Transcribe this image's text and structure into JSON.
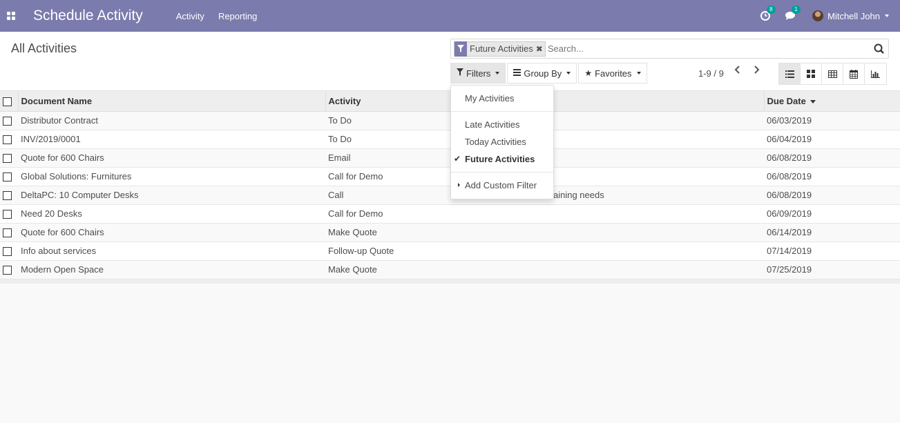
{
  "navbar": {
    "app_title": "Schedule Activity",
    "menu": [
      "Activity",
      "Reporting"
    ],
    "activity_badge": "8",
    "message_badge": "1",
    "user_name": "Mitchell John"
  },
  "control_panel": {
    "breadcrumb": "All Activities",
    "search": {
      "facet_label": "Future Activities",
      "placeholder": "Search..."
    },
    "buttons": {
      "filters": "Filters",
      "group_by": "Group By",
      "favorites": "Favorites"
    },
    "pager": "1-9 / 9"
  },
  "filters_dropdown": {
    "items": [
      "My Activities",
      "Late Activities",
      "Today Activities",
      "Future Activities",
      "Add Custom Filter"
    ],
    "checked": "Future Activities"
  },
  "table": {
    "columns": [
      "Document Name",
      "Activity",
      "Summary",
      "Due Date"
    ],
    "rows": [
      {
        "document": "Distributor Contract",
        "activity": "To Do",
        "summary": "",
        "due": "06/03/2019"
      },
      {
        "document": "INV/2019/0001",
        "activity": "To Do",
        "summary": "",
        "due": "06/04/2019"
      },
      {
        "document": "Quote for 600 Chairs",
        "activity": "Email",
        "summary": "",
        "due": "06/08/2019"
      },
      {
        "document": "Global Solutions: Furnitures",
        "activity": "Call for Demo",
        "summary": "",
        "due": "06/08/2019"
      },
      {
        "document": "DeltaPC: 10 Computer Desks",
        "activity": "Call",
        "summary": "aining needs",
        "due": "06/08/2019"
      },
      {
        "document": "Need 20 Desks",
        "activity": "Call for Demo",
        "summary": "",
        "due": "06/09/2019"
      },
      {
        "document": "Quote for 600 Chairs",
        "activity": "Make Quote",
        "summary": "",
        "due": "06/14/2019"
      },
      {
        "document": "Info about services",
        "activity": "Follow-up Quote",
        "summary": "",
        "due": "07/14/2019"
      },
      {
        "document": "Modern Open Space",
        "activity": "Make Quote",
        "summary": "",
        "due": "07/25/2019"
      }
    ]
  },
  "colors": {
    "brand": "#7c7bad",
    "badge": "#00a09d"
  }
}
